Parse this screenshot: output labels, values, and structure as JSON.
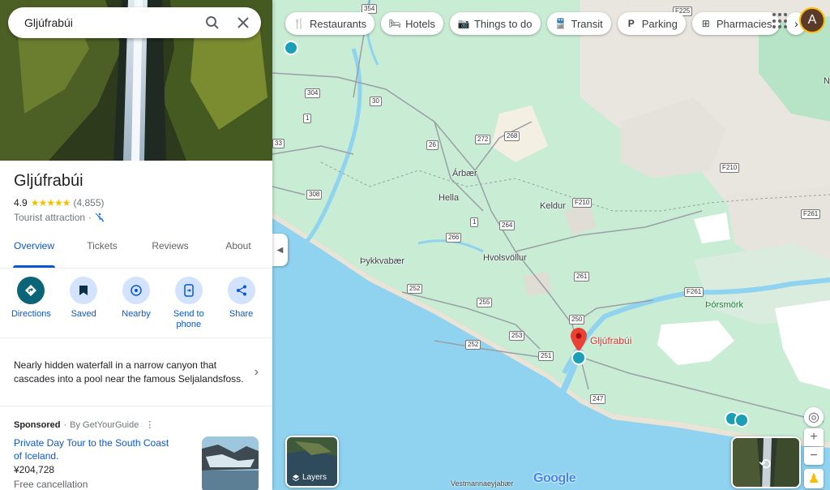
{
  "search": {
    "value": "Gljúfrabúi"
  },
  "place": {
    "name": "Gljúfrabúi",
    "rating": "4.9",
    "stars": "★★★★★",
    "reviews_count": "(4,855)",
    "category": "Tourist attraction",
    "separator": "·"
  },
  "tabs": [
    {
      "label": "Overview",
      "active": true
    },
    {
      "label": "Tickets"
    },
    {
      "label": "Reviews"
    },
    {
      "label": "About"
    }
  ],
  "actions": [
    {
      "label": "Directions",
      "icon": "directions-icon"
    },
    {
      "label": "Saved",
      "icon": "bookmark-icon"
    },
    {
      "label": "Nearby",
      "icon": "nearby-icon"
    },
    {
      "label": "Send to phone",
      "icon": "send-to-phone-icon"
    },
    {
      "label": "Share",
      "icon": "share-icon"
    }
  ],
  "description": "Nearly hidden waterfall in a narrow canyon that cascades into a pool near the famous Seljalandsfoss.",
  "sponsored": {
    "label": "Sponsored",
    "by": "By GetYourGuide",
    "title": "Private Day Tour to the South Coast of Iceland.",
    "price": "¥204,728",
    "cancellation": "Free cancellation"
  },
  "chips": [
    {
      "label": "Restaurants",
      "icon": "restaurant-icon"
    },
    {
      "label": "Hotels",
      "icon": "hotel-icon"
    },
    {
      "label": "Things to do",
      "icon": "camera-icon"
    },
    {
      "label": "Transit",
      "icon": "transit-icon"
    },
    {
      "label": "Parking",
      "icon": "parking-icon"
    },
    {
      "label": "Pharmacies",
      "icon": "pharmacy-icon"
    }
  ],
  "account": {
    "initial": "A"
  },
  "layers_label": "Layers",
  "map": {
    "pin_label": "Gljúfrabúi",
    "places": {
      "arbaer": "Árbær",
      "hella": "Hella",
      "keldur": "Keldur",
      "thykkvabaer": "Þykkvabær",
      "hvolsvollur": "Hvolsvöllur",
      "thorsmork": "Þórsmörk",
      "vestmannaeyjabaer": "Vestmannaeyjabær"
    },
    "roads": {
      "r354": "354",
      "r304": "304",
      "r30": "30",
      "r1a": "1",
      "r33": "33",
      "r26": "26",
      "r272": "272",
      "r268": "268",
      "r308": "308",
      "r1b": "1",
      "r264": "264",
      "r266": "266",
      "r252a": "252",
      "r255": "255",
      "r253": "253",
      "r252b": "252",
      "r251": "251",
      "r250": "250",
      "r247": "247",
      "r261": "261",
      "rF261": "F261",
      "rF210a": "F210",
      "rF210b": "F210",
      "rF261b": "F261",
      "rF225": "F225"
    },
    "edge_letter": "N"
  },
  "attribution": "Google",
  "colors": {
    "accent": "#0b57d0",
    "pin": "#ea4335",
    "water": "#8fd3f0",
    "land": "#c9ecd6"
  }
}
